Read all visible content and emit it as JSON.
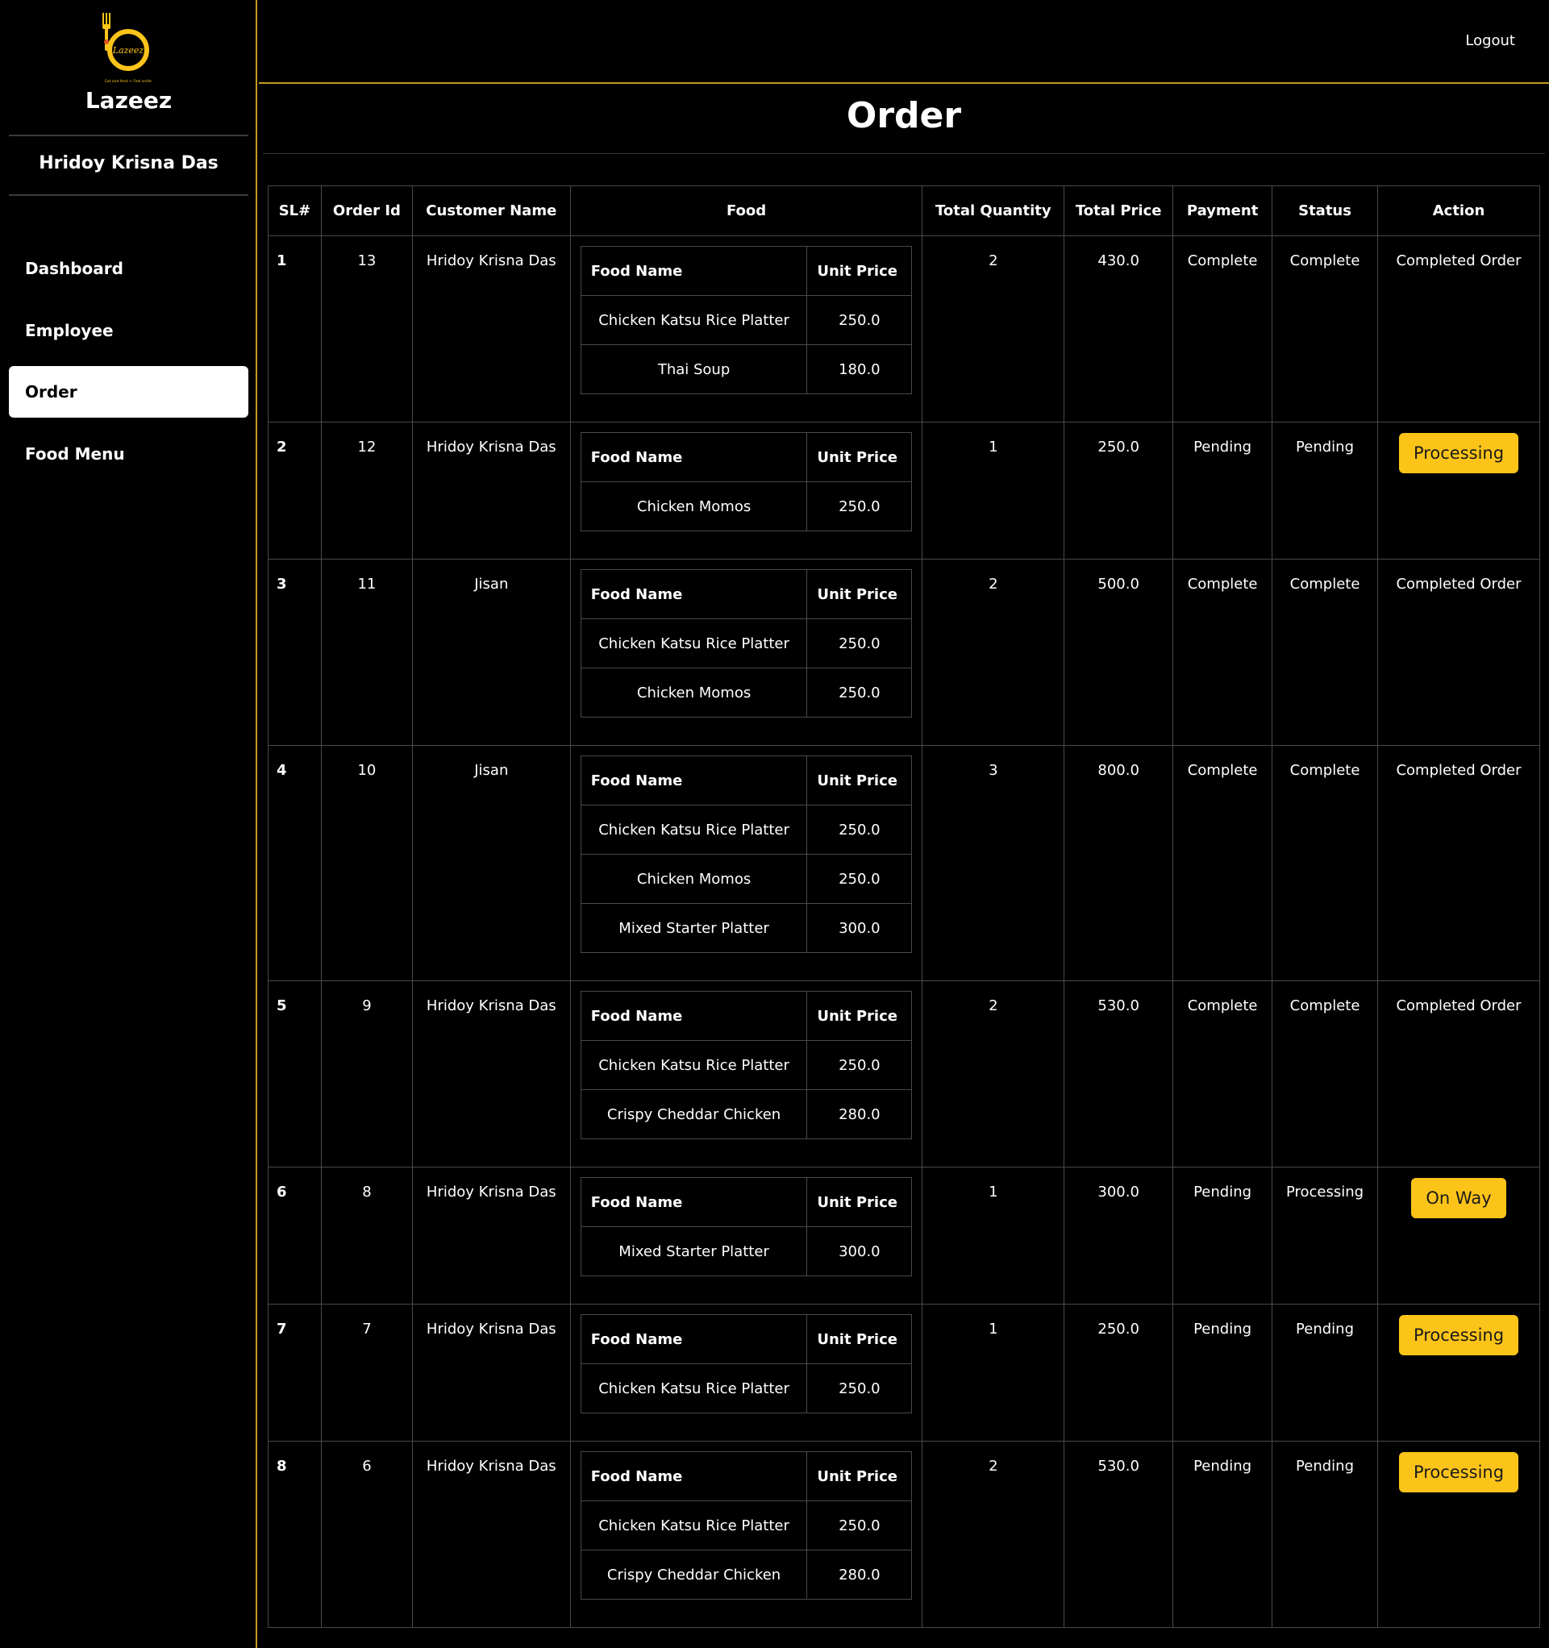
{
  "brand": {
    "name": "Lazeez",
    "logo_text": "Lazeez",
    "logo_tagline": "Eat and feed + Feel smile",
    "accent_color": "#fcc419",
    "border_color": "#c79a1e"
  },
  "sidebar": {
    "user_name": "Hridoy Krisna Das",
    "items": [
      {
        "label": "Dashboard",
        "active": false
      },
      {
        "label": "Employee",
        "active": false
      },
      {
        "label": "Order",
        "active": true
      },
      {
        "label": "Food Menu",
        "active": false
      }
    ]
  },
  "header": {
    "logout_label": "Logout"
  },
  "page": {
    "title": "Order"
  },
  "table": {
    "columns": [
      "SL#",
      "Order Id",
      "Customer Name",
      "Food",
      "Total Quantity",
      "Total Price",
      "Payment",
      "Status",
      "Action"
    ],
    "inner_columns": [
      "Food Name",
      "Unit Price"
    ],
    "rows": [
      {
        "sl": "1",
        "order_id": "13",
        "customer": "Hridoy Krisna Das",
        "foods": [
          {
            "name": "Chicken Katsu Rice Platter",
            "price": "250.0"
          },
          {
            "name": "Thai Soup",
            "price": "180.0"
          }
        ],
        "quantity": "2",
        "total": "430.0",
        "payment": "Complete",
        "status": "Complete",
        "action": {
          "type": "text",
          "label": "Completed Order"
        }
      },
      {
        "sl": "2",
        "order_id": "12",
        "customer": "Hridoy Krisna Das",
        "foods": [
          {
            "name": "Chicken Momos",
            "price": "250.0"
          }
        ],
        "quantity": "1",
        "total": "250.0",
        "payment": "Pending",
        "status": "Pending",
        "action": {
          "type": "button",
          "label": "Processing"
        }
      },
      {
        "sl": "3",
        "order_id": "11",
        "customer": "Jisan",
        "foods": [
          {
            "name": "Chicken Katsu Rice Platter",
            "price": "250.0"
          },
          {
            "name": "Chicken Momos",
            "price": "250.0"
          }
        ],
        "quantity": "2",
        "total": "500.0",
        "payment": "Complete",
        "status": "Complete",
        "action": {
          "type": "text",
          "label": "Completed Order"
        }
      },
      {
        "sl": "4",
        "order_id": "10",
        "customer": "Jisan",
        "foods": [
          {
            "name": "Chicken Katsu Rice Platter",
            "price": "250.0"
          },
          {
            "name": "Chicken Momos",
            "price": "250.0"
          },
          {
            "name": "Mixed Starter Platter",
            "price": "300.0"
          }
        ],
        "quantity": "3",
        "total": "800.0",
        "payment": "Complete",
        "status": "Complete",
        "action": {
          "type": "text",
          "label": "Completed Order"
        }
      },
      {
        "sl": "5",
        "order_id": "9",
        "customer": "Hridoy Krisna Das",
        "foods": [
          {
            "name": "Chicken Katsu Rice Platter",
            "price": "250.0"
          },
          {
            "name": "Crispy Cheddar Chicken",
            "price": "280.0"
          }
        ],
        "quantity": "2",
        "total": "530.0",
        "payment": "Complete",
        "status": "Complete",
        "action": {
          "type": "text",
          "label": "Completed Order"
        }
      },
      {
        "sl": "6",
        "order_id": "8",
        "customer": "Hridoy Krisna Das",
        "foods": [
          {
            "name": "Mixed Starter Platter",
            "price": "300.0"
          }
        ],
        "quantity": "1",
        "total": "300.0",
        "payment": "Pending",
        "status": "Processing",
        "action": {
          "type": "button",
          "label": "On Way"
        }
      },
      {
        "sl": "7",
        "order_id": "7",
        "customer": "Hridoy Krisna Das",
        "foods": [
          {
            "name": "Chicken Katsu Rice Platter",
            "price": "250.0"
          }
        ],
        "quantity": "1",
        "total": "250.0",
        "payment": "Pending",
        "status": "Pending",
        "action": {
          "type": "button",
          "label": "Processing"
        }
      },
      {
        "sl": "8",
        "order_id": "6",
        "customer": "Hridoy Krisna Das",
        "foods": [
          {
            "name": "Chicken Katsu Rice Platter",
            "price": "250.0"
          },
          {
            "name": "Crispy Cheddar Chicken",
            "price": "280.0"
          }
        ],
        "quantity": "2",
        "total": "530.0",
        "payment": "Pending",
        "status": "Pending",
        "action": {
          "type": "button",
          "label": "Processing"
        }
      }
    ]
  }
}
